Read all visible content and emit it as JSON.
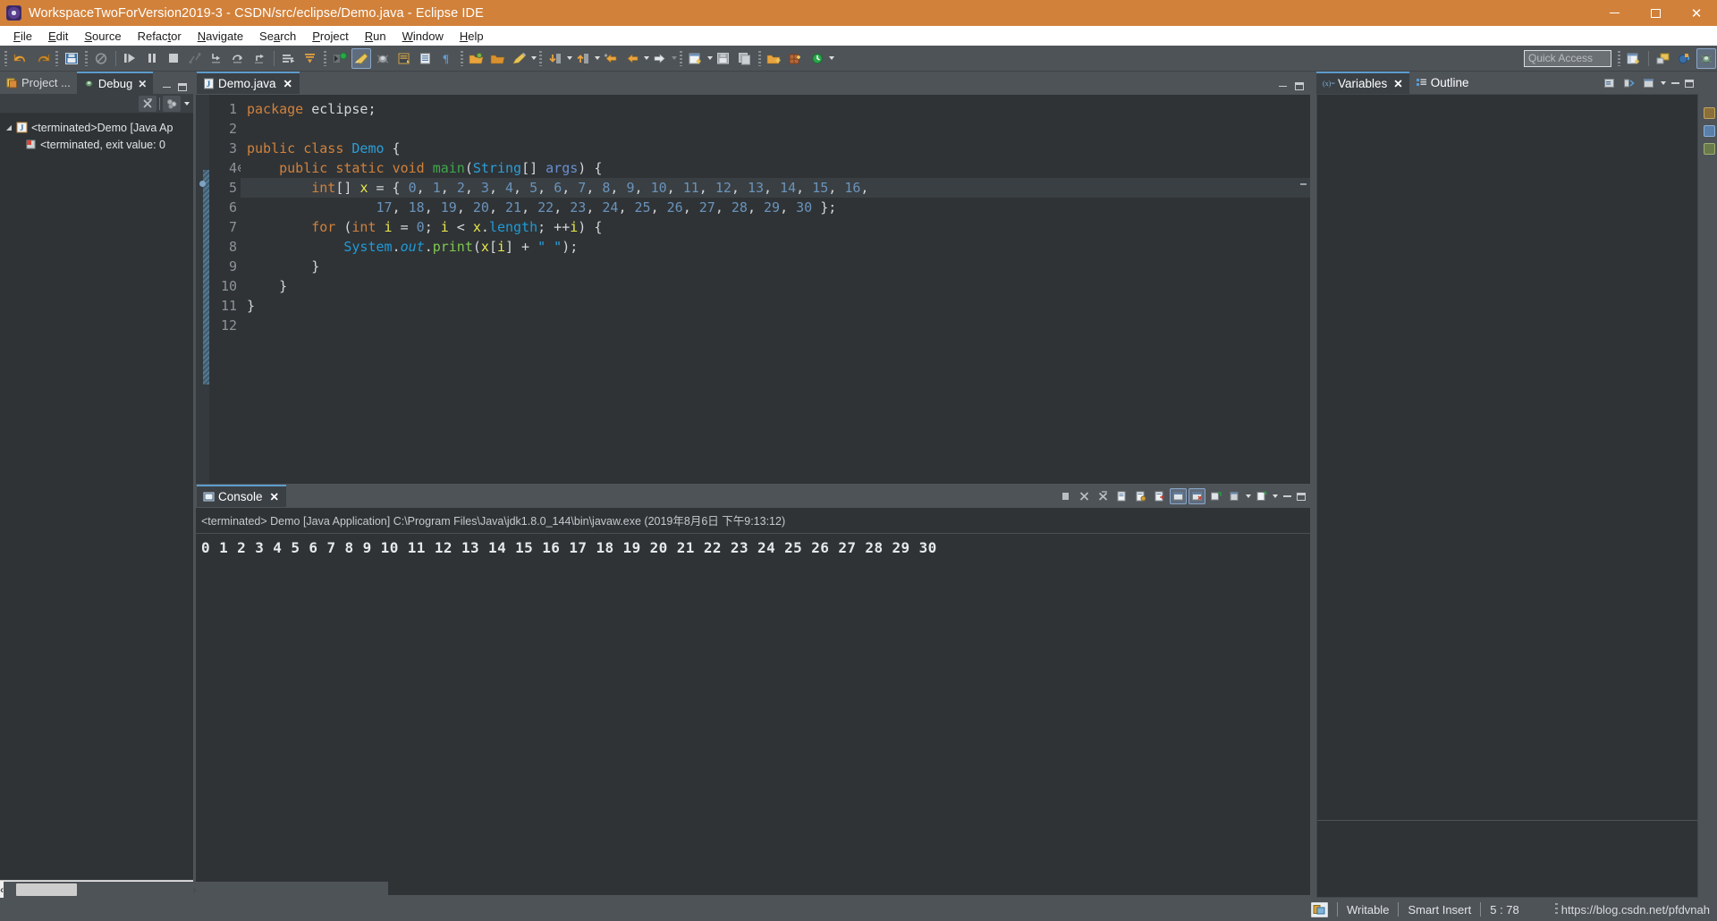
{
  "window": {
    "title": "WorkspaceTwoForVersion2019-3 - CSDN/src/eclipse/Demo.java - Eclipse IDE",
    "icon": "eclipse-icon",
    "minimize": "−",
    "maximize": "□",
    "close": "✕",
    "titlebar_color": "#d2813a"
  },
  "menubar": {
    "items": [
      {
        "label": "File",
        "mnemonic": "F"
      },
      {
        "label": "Edit",
        "mnemonic": "E"
      },
      {
        "label": "Source",
        "mnemonic": "S"
      },
      {
        "label": "Refactor",
        "mnemonic": "t"
      },
      {
        "label": "Navigate",
        "mnemonic": "N"
      },
      {
        "label": "Search",
        "mnemonic": "a"
      },
      {
        "label": "Project",
        "mnemonic": "P"
      },
      {
        "label": "Run",
        "mnemonic": "R"
      },
      {
        "label": "Window",
        "mnemonic": "W"
      },
      {
        "label": "Help",
        "mnemonic": "H"
      }
    ]
  },
  "toolbar": {
    "quick_access_placeholder": "Quick Access",
    "icons": [
      "undo-icon",
      "redo-icon",
      "save-icon",
      "skip-breakpoints-icon",
      "resume-icon",
      "suspend-icon",
      "terminate-icon",
      "disconnect-icon",
      "step-into-icon",
      "step-over-icon",
      "step-return-icon",
      "drop-to-frame-icon",
      "use-step-filters-icon",
      "run-last-tool-icon",
      "external-tools-icon",
      "debug-icon",
      "new-java-project-icon",
      "new-java-package-icon",
      "pilcrow-icon",
      "open-type-icon",
      "open-task-icon",
      "edit-icon",
      "next-annotation-icon",
      "previous-annotation-icon",
      "back-icon",
      "forward-icon",
      "new-wizard-icon",
      "save-all-icon",
      "copy-icon",
      "new-folder-icon",
      "new-class-icon",
      "refresh-icon"
    ],
    "perspective_icons": [
      "open-perspective-icon",
      "java-perspective-icon",
      "java-ee-perspective-icon",
      "debug-perspective-icon"
    ]
  },
  "left_panel": {
    "tabs": [
      {
        "label": "Project ...",
        "icon": "project-explorer-icon",
        "active": false,
        "closeable": false
      },
      {
        "label": "Debug",
        "icon": "debug-view-icon",
        "active": true,
        "closeable": true,
        "close": "✕"
      }
    ],
    "view_toolbar": [
      "remove-all-terminated-icon",
      "view-menu-icon",
      "view-dropdown-icon"
    ],
    "tree": [
      {
        "twisty": "◢",
        "icon": "java-launch-icon",
        "label": "<terminated>Demo [Java Ap",
        "indent": 0
      },
      {
        "twisty": "",
        "icon": "terminated-process-icon",
        "label": "<terminated, exit value: 0",
        "indent": 1
      }
    ],
    "hscroll": {
      "left_arrow": "‹",
      "right_arrow": "›"
    }
  },
  "editor": {
    "tab": {
      "label": "Demo.java",
      "icon": "java-file-icon",
      "close": "✕"
    },
    "window_buttons": [
      "minimize-icon",
      "maximize-icon"
    ],
    "current_line": 5,
    "breakpoint_line": 5,
    "fold_line": 4,
    "lines": [
      {
        "n": 1,
        "html": "<span class=\"kw\">package</span> eclipse;"
      },
      {
        "n": 2,
        "html": ""
      },
      {
        "n": 3,
        "html": "<span class=\"kw\">public</span> <span class=\"kw\">class</span> <span class=\"type\">Demo</span> {"
      },
      {
        "n": 4,
        "html": "    <span class=\"kw\">public</span> <span class=\"kw\">static</span> <span class=\"kw\">void</span> <span class=\"meth\">main</span>(<span class=\"type\">String</span>[] <span class=\"param\">args</span>) {",
        "fold": true
      },
      {
        "n": 5,
        "html": "        <span class=\"kw\">int</span>[] <span class=\"var\">x</span> = { <span class=\"num\">0</span>, <span class=\"num\">1</span>, <span class=\"num\">2</span>, <span class=\"num\">3</span>, <span class=\"num\">4</span>, <span class=\"num\">5</span>, <span class=\"num\">6</span>, <span class=\"num\">7</span>, <span class=\"num\">8</span>, <span class=\"num\">9</span>, <span class=\"num\">10</span>, <span class=\"num\">11</span>, <span class=\"num\">12</span>, <span class=\"num\">13</span>, <span class=\"num\">14</span>, <span class=\"num\">15</span>, <span class=\"num\">16</span>,",
        "highlight": true
      },
      {
        "n": 6,
        "html": "                <span class=\"num\">17</span>, <span class=\"num\">18</span>, <span class=\"num\">19</span>, <span class=\"num\">20</span>, <span class=\"num\">21</span>, <span class=\"num\">22</span>, <span class=\"num\">23</span>, <span class=\"num\">24</span>, <span class=\"num\">25</span>, <span class=\"num\">26</span>, <span class=\"num\">27</span>, <span class=\"num\">28</span>, <span class=\"num\">29</span>, <span class=\"num\">30</span> };"
      },
      {
        "n": 7,
        "html": "        <span class=\"kw\">for</span> (<span class=\"kw\">int</span> <span class=\"var\">i</span> = <span class=\"num\">0</span>; <span class=\"var\">i</span> &lt; <span class=\"var\">x</span>.<span class=\"fld\">length</span>; ++<span class=\"var\">i</span>) {"
      },
      {
        "n": 8,
        "html": "            <span class=\"fld\">System</span>.<span class=\"fld ital\">out</span>.<span class=\"prt\">print</span>(<span class=\"var\">x</span>[<span class=\"var\">i</span>] + <span class=\"str\">\" \"</span>);"
      },
      {
        "n": 9,
        "html": "        }"
      },
      {
        "n": 10,
        "html": "    }"
      },
      {
        "n": 11,
        "html": "}"
      },
      {
        "n": 12,
        "html": ""
      }
    ],
    "source_text": "package eclipse;\n\npublic class Demo {\n    public static void main(String[] args) {\n        int[] x = { 0, 1, 2, 3, 4, 5, 6, 7, 8, 9, 10, 11, 12, 13, 14, 15, 16,\n                17, 18, 19, 20, 21, 22, 23, 24, 25, 26, 27, 28, 29, 30 };\n        for (int i = 0; i < x.length; ++i) {\n            System.out.print(x[i] + \" \");\n        }\n    }\n}\n"
  },
  "console": {
    "tab": {
      "label": "Console",
      "icon": "console-icon",
      "close": "✕"
    },
    "toolbar_icons": [
      "terminate-icon",
      "remove-launch-icon",
      "remove-all-launches-icon",
      "clear-console-icon",
      "scroll-lock-icon",
      "word-wrap-icon",
      "show-console-on-output-icon",
      "pin-console-icon",
      "display-selected-console-icon",
      "open-console-icon",
      "minimize-icon",
      "maximize-icon"
    ],
    "launch_line": "<terminated> Demo [Java Application] C:\\Program Files\\Java\\jdk1.8.0_144\\bin\\javaw.exe (2019年8月6日 下午9:13:12)",
    "output": "0 1 2 3 4 5 6 7 8 9 10 11 12 13 14 15 16 17 18 19 20 21 22 23 24 25 26 27 28 29 30"
  },
  "right_panel": {
    "window_buttons": [
      "minimize-icon",
      "maximize-icon"
    ],
    "tabs": [
      {
        "label": "Variables",
        "icon": "variables-icon",
        "active": true,
        "close": "✕"
      },
      {
        "label": "Outline",
        "icon": "outline-icon",
        "active": false
      }
    ],
    "toolbar_icons": [
      "collapse-all-icon",
      "show-logical-structure-icon",
      "view-menu-icon",
      "view-dropdown-icon",
      "minimize-icon",
      "maximize-icon"
    ],
    "content": ""
  },
  "statusbar": {
    "icon": "writable-indicator-icon",
    "writable": "Writable",
    "insert_mode": "Smart Insert",
    "cursor_position": "5 : 78",
    "watermark": "https://blog.csdn.net/pfdvnah"
  }
}
